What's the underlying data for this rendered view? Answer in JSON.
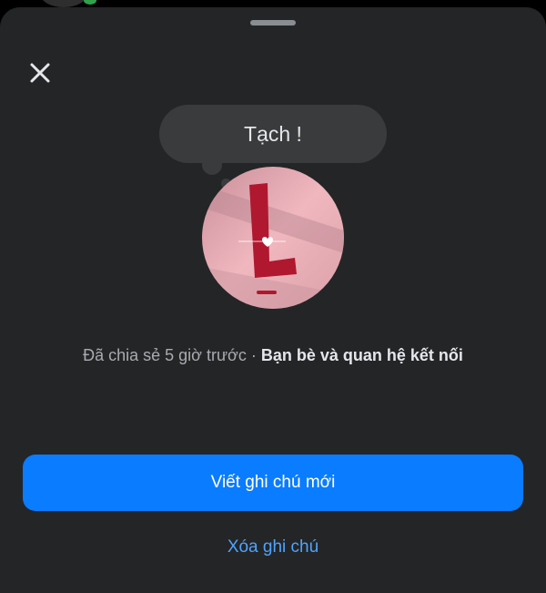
{
  "note": {
    "text": "Tạch !"
  },
  "meta": {
    "shared_time": "Đã chia sẻ 5 giờ trước",
    "separator": " · ",
    "audience": "Bạn bè và quan hệ kết nối"
  },
  "actions": {
    "new_note_label": "Viết ghi chú mới",
    "delete_note_label": "Xóa ghi chú"
  },
  "icons": {
    "close": "close-icon",
    "grabber": "drag-handle-icon"
  },
  "colors": {
    "sheet_background": "#242526",
    "primary_button": "#0a7cff",
    "link": "#4fa3ff",
    "bubble": "#3a3b3c",
    "online_status": "#31a24c"
  }
}
